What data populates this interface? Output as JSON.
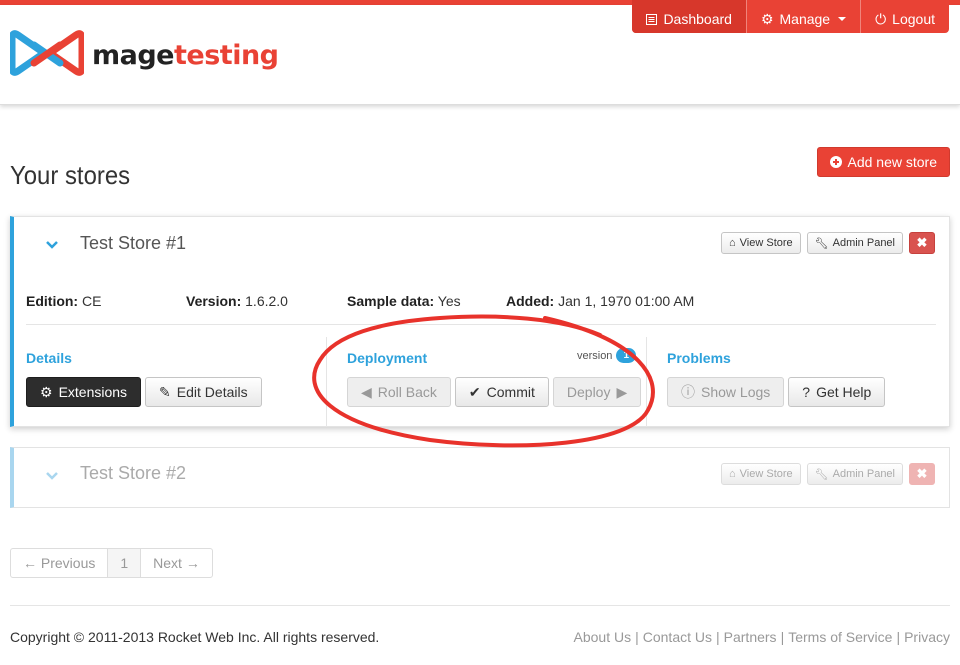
{
  "brand": {
    "name_part1": "mage",
    "name_part2": "testing",
    "accent": "#e94235",
    "blue": "#2ea2dc"
  },
  "nav": {
    "dashboard": "Dashboard",
    "manage": "Manage",
    "logout": "Logout"
  },
  "page": {
    "title": "Your stores",
    "add_button": "Add new store"
  },
  "stores": [
    {
      "name": "Test Store #1",
      "view_store": "View Store",
      "admin_panel": "Admin Panel",
      "edition_label": "Edition:",
      "edition": "CE",
      "version_label": "Version:",
      "version": "1.6.2.0",
      "sample_label": "Sample data:",
      "sample": "Yes",
      "added_label": "Added:",
      "added": "Jan 1, 1970 01:00 AM",
      "details": {
        "heading": "Details",
        "extensions": "Extensions",
        "edit": "Edit Details"
      },
      "deployment": {
        "heading": "Deployment",
        "version_text": "version",
        "version_badge": "1",
        "rollback": "Roll Back",
        "commit": "Commit",
        "deploy": "Deploy"
      },
      "problems": {
        "heading": "Problems",
        "logs": "Show Logs",
        "help": "Get Help"
      }
    },
    {
      "name": "Test Store #2",
      "view_store": "View Store",
      "admin_panel": "Admin Panel"
    }
  ],
  "pager": {
    "prev": "← Previous",
    "current": "1",
    "next": "Next →"
  },
  "footer": {
    "copyright": "Copyright © 2011-2013 Rocket Web Inc. All rights reserved.",
    "links": [
      "About Us",
      "Contact Us",
      "Partners",
      "Terms of Service",
      "Privacy"
    ],
    "separator": "|"
  }
}
